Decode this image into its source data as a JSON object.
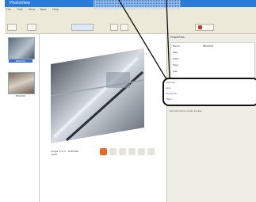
{
  "window": {
    "title": "PhotoView"
  },
  "menu": [
    "File",
    "Edit",
    "View",
    "Tools",
    "Help"
  ],
  "thumbnails": [
    {
      "label": "IMG0001",
      "caption": ""
    },
    {
      "label": "",
      "caption": "IMG0002"
    }
  ],
  "viewer": {
    "info_line1": "Image 1 of 2 · 640x480",
    "info_line2": "100%"
  },
  "properties": {
    "header": "Properties",
    "rows": [
      {
        "k": "Name",
        "v": "IMG0001"
      },
      {
        "k": "Size",
        "v": ""
      },
      {
        "k": "Date",
        "v": ""
      },
      {
        "k": "Type",
        "v": ""
      },
      {
        "k": "Size",
        "v": ""
      }
    ],
    "links": [
      "Camera",
      "Lens",
      "Exposure",
      "Flash"
    ],
    "description": "Rail structure under bridge"
  },
  "colors": {
    "titlebar": "#2a7bd8",
    "chrome": "#ece9d8",
    "accent_button": "#e86a2a",
    "link": "#4a57c4"
  }
}
